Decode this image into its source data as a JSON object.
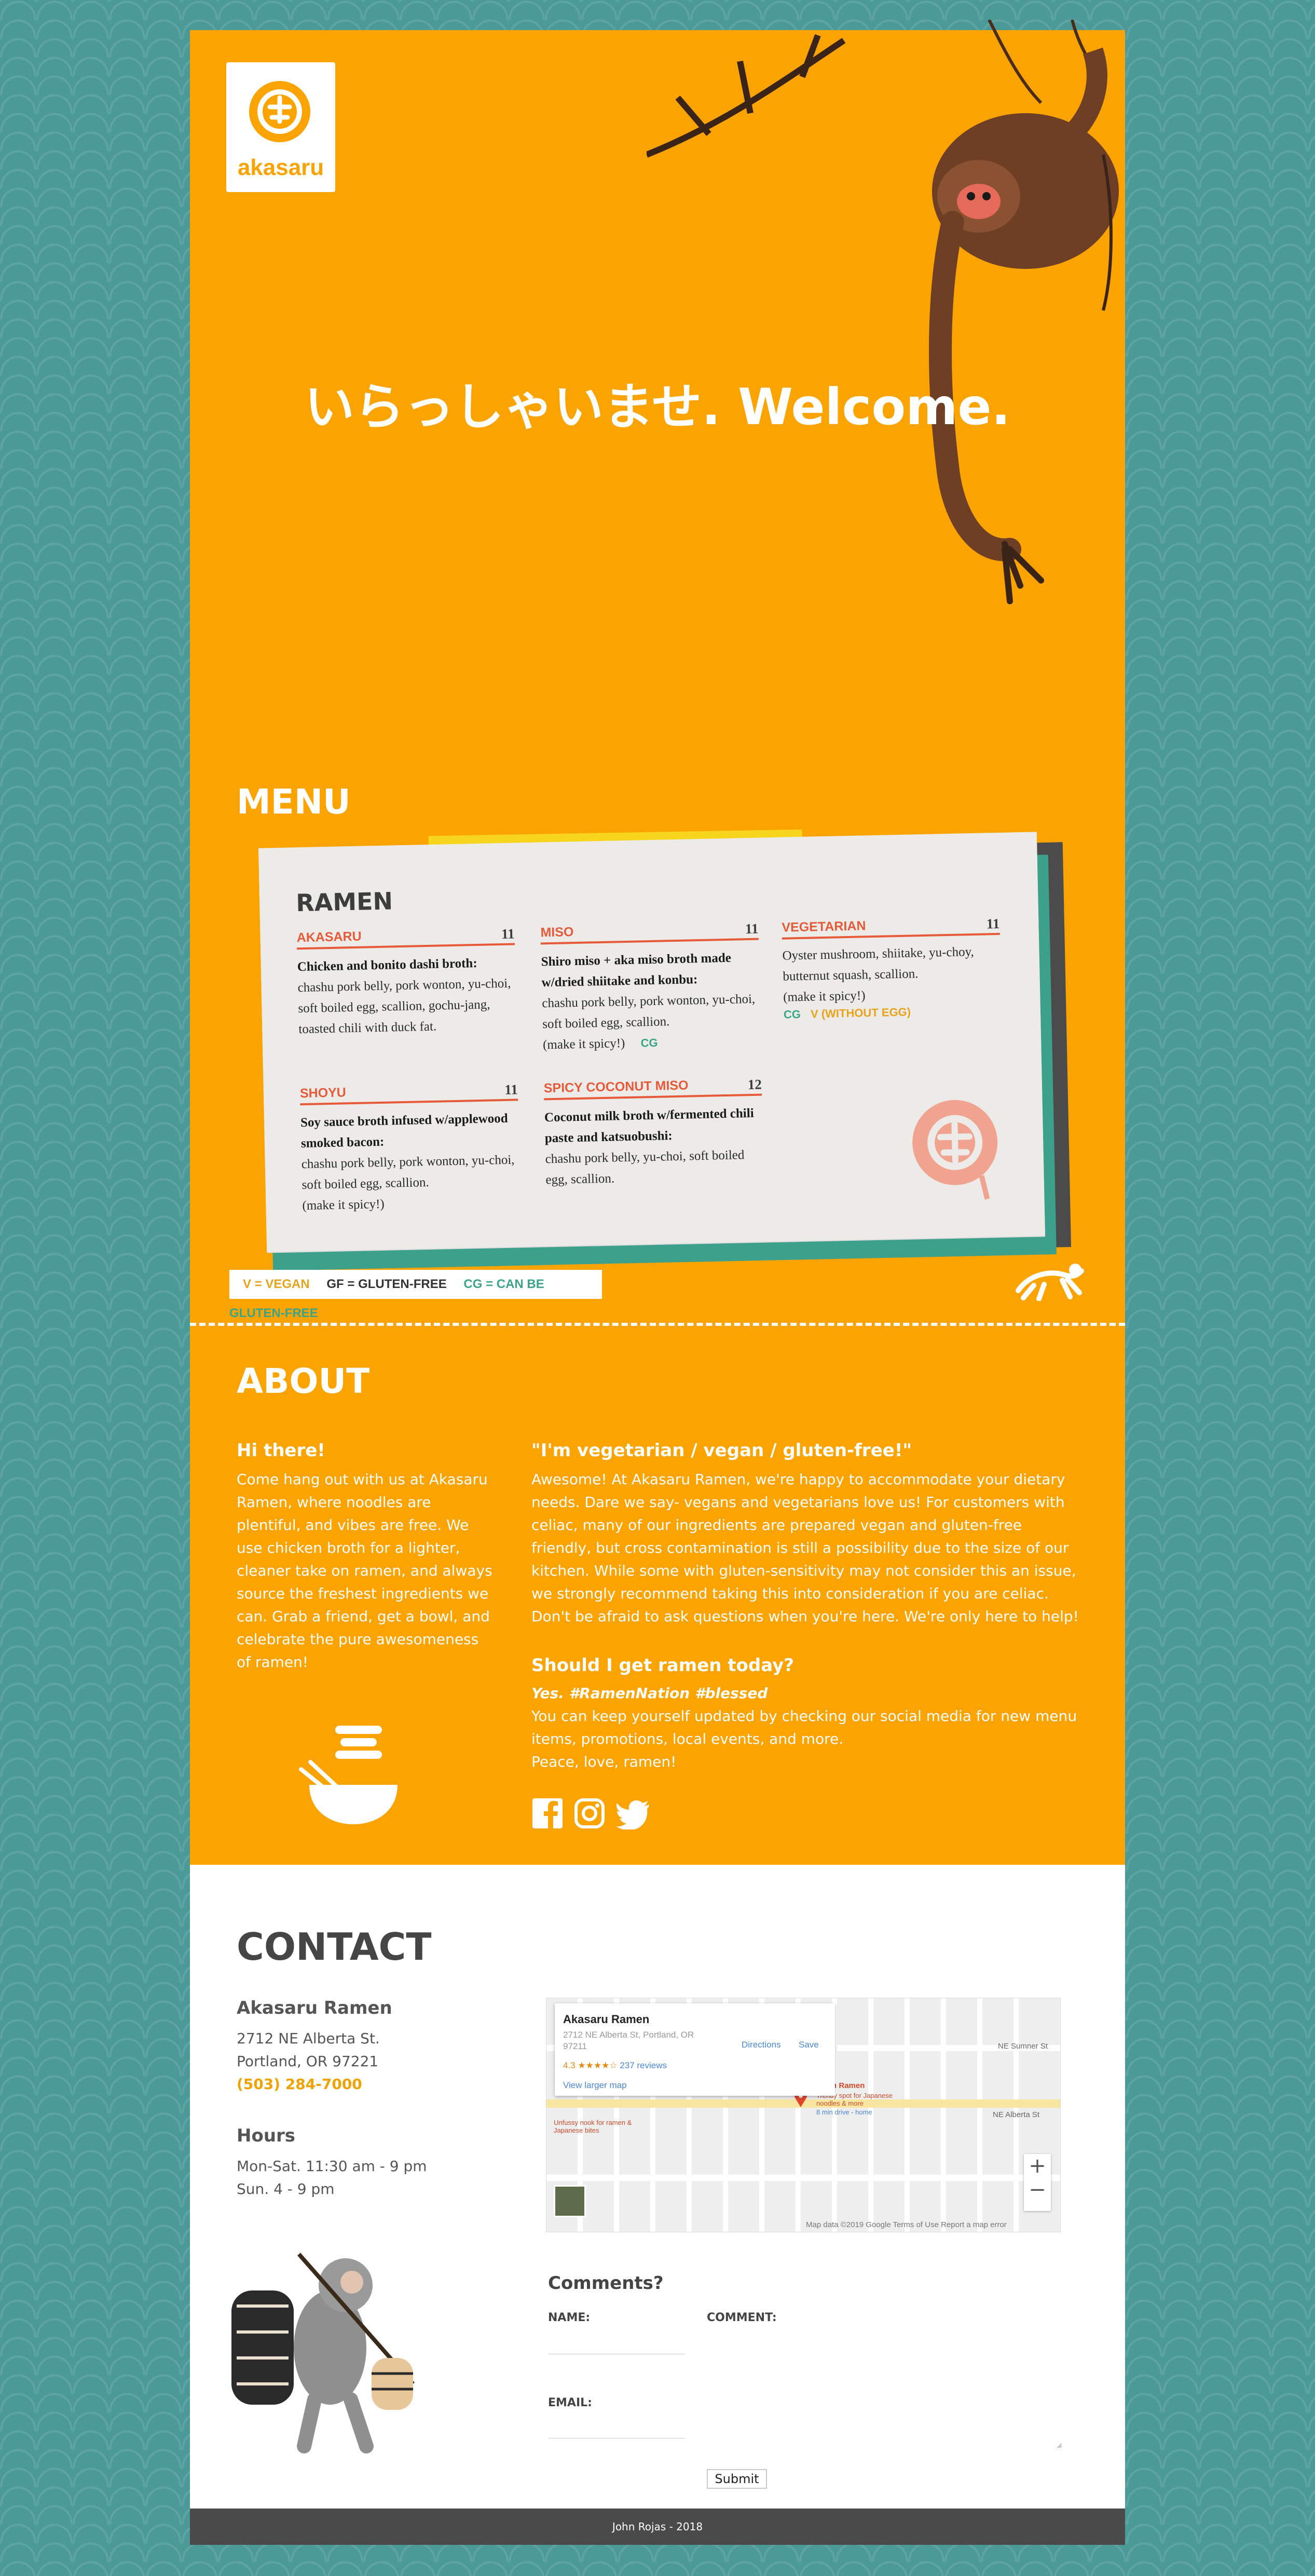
{
  "hero": {
    "logo_text": "akasaru",
    "welcome": "いらっしゃいませ. Welcome."
  },
  "menu": {
    "section_title": "MENU",
    "card_title": "RAMEN",
    "items": [
      {
        "name": "AKASARU",
        "price": "11",
        "lead": "Chicken and bonito dashi broth:",
        "desc": "chashu pork belly, pork wonton, yu-choi, soft boiled egg, scallion, gochu-jang, toasted chili with duck fat."
      },
      {
        "name": "MISO",
        "price": "11",
        "lead": "Shiro miso + aka miso broth made w/dried shiitake and konbu:",
        "desc": "chashu pork belly, pork wonton, yu-choi, soft boiled egg, scallion.",
        "extra": "(make it spicy!)",
        "tag": "CG"
      },
      {
        "name": "VEGETARIAN",
        "price": "11",
        "desc": "Oyster mushroom, shiitake, yu-choy, butternut squash, scallion.",
        "extra": "(make it spicy!)",
        "tag": "CG",
        "tag2": "V (WITHOUT EGG)"
      },
      {
        "name": "SHOYU",
        "price": "11",
        "lead": "Soy sauce broth infused w/applewood smoked bacon:",
        "desc": "chashu pork belly, pork wonton, yu-choi, soft boiled egg, scallion.",
        "extra": "(make it spicy!)"
      },
      {
        "name": "SPICY COCONUT MISO",
        "price": "12",
        "lead": "Coconut milk broth w/fermented chili paste and katsuobushi:",
        "desc": "chashu pork belly, yu-choi, soft boiled egg, scallion."
      }
    ],
    "legend": {
      "v": "V = VEGAN",
      "gf": "GF = GLUTEN-FREE",
      "cg": "CG = CAN BE GLUTEN-FREE"
    }
  },
  "about": {
    "section_title": "ABOUT",
    "col1_title": "Hi there!",
    "col1_text": "Come hang out with us at Akasaru Ramen, where noodles are plentiful, and vibes are free. We use chicken broth for a lighter, cleaner take on ramen, and always source the freshest ingredients we can. Grab a friend, get a bowl, and celebrate the pure awesomeness of ramen!",
    "col2_title": "\"I'm vegetarian / vegan / gluten-free!\"",
    "col2_text": "Awesome! At Akasaru Ramen, we're happy to accommodate your dietary needs. Dare we say- vegans and vegetarians love us! For customers with celiac, many of our ingredients are prepared vegan and gluten-free friendly, but cross contamination is still a possibility due to the size of our kitchen. While some with gluten-sensitivity may not consider this an issue, we strongly recommend taking this into consideration if you are celiac. Don't be afraid to ask questions when you're here. We're only here to help!",
    "col3_title": "Should I get ramen today?",
    "col3_lead": "Yes. #RamenNation #blessed",
    "col3_text": "You can keep yourself updated by checking our social media for new menu items, promotions, local events, and more.",
    "col3_sign": "Peace, love, ramen!"
  },
  "contact": {
    "section_title": "CONTACT",
    "name": "Akasaru Ramen",
    "address1": "2712 NE Alberta St.",
    "address2": "Portland, OR 97221",
    "phone": "(503) 284-7000",
    "hours_title": "Hours",
    "hours1": "Mon-Sat. 11:30 am - 9 pm",
    "hours2": "Sun. 4 - 9 pm",
    "map": {
      "place": "Akasaru Ramen",
      "address": "2712 NE Alberta St, Portland, OR 97211",
      "rating": "4.3 ★★★★☆",
      "reviews": "237 reviews",
      "view_larger": "View larger map",
      "directions": "Directions",
      "save": "Save",
      "footer": "Map data ©2019 Google   Terms of Use   Report a map error",
      "pin_label": "Akasaru Ramen",
      "pin_sub": "Trendy spot for Japanese noodles & more",
      "pin_drive": "8 min drive - home",
      "street1": "NE Alberta St",
      "street2": "NE Sumner St",
      "biker": "Unfussy nook for ramen & Japanese bites"
    },
    "form_title": "Comments?",
    "name_label": "NAME:",
    "comment_label": "COMMENT:",
    "email_label": "EMAIL:",
    "submit": "Submit"
  },
  "footer": {
    "text": "John Rojas - 2018"
  },
  "colors": {
    "orange": "#fba300",
    "teal": "#4c9a98",
    "red": "#e65a3a",
    "green": "#3aa58a"
  }
}
